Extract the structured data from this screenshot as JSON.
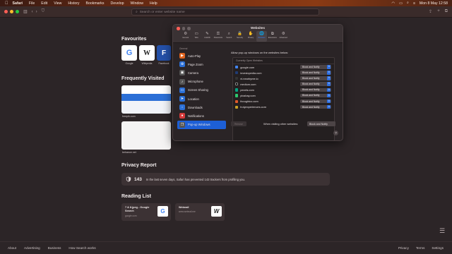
{
  "menubar": {
    "app": "Safari",
    "items": [
      "File",
      "Edit",
      "View",
      "History",
      "Bookmarks",
      "Develop",
      "Window",
      "Help"
    ],
    "datetime": "Mon 8 May  12:58"
  },
  "toolbar": {
    "address_placeholder": "Search or enter website name"
  },
  "start_page": {
    "favourites_title": "Favourites",
    "favourites": [
      {
        "label": "Google",
        "glyph": "G",
        "color": "#4285F4",
        "bg": "#ffffff"
      },
      {
        "label": "Wikipedia",
        "glyph": "W",
        "color": "#222222",
        "bg": "#ffffff"
      },
      {
        "label": "Facebook",
        "glyph": "F",
        "color": "#ffffff",
        "bg": "#2450a8"
      }
    ],
    "frequently_title": "Frequently Visited",
    "frequently": [
      {
        "label": "freepik.com"
      },
      {
        "label": "behance.net"
      }
    ],
    "privacy_title": "Privacy Report",
    "privacy_count": "143",
    "privacy_text": "In the last seven days, Safari has prevented 143 trackers from profiling you.",
    "reading_title": "Reading List",
    "reading": [
      {
        "title": "7 & 8.jpeg - Google Search",
        "sub": "google.com",
        "glyph": "G",
        "color": "#4285F4"
      },
      {
        "title": "Webnail",
        "sub": "www.webnail.me",
        "glyph": "W",
        "color": "#222222"
      }
    ]
  },
  "footer": {
    "left": [
      "About",
      "Advertising",
      "Business",
      "How Search works"
    ],
    "right": [
      "Privacy",
      "Terms",
      "Settings"
    ]
  },
  "prefs": {
    "title": "Websites",
    "tabs": [
      {
        "label": "General",
        "icon": "⚙"
      },
      {
        "label": "Tabs",
        "icon": "▭"
      },
      {
        "label": "AutoFill",
        "icon": "✎"
      },
      {
        "label": "Passwords",
        "icon": "⚿"
      },
      {
        "label": "Search",
        "icon": "⌕"
      },
      {
        "label": "Security",
        "icon": "🔒"
      },
      {
        "label": "Privacy",
        "icon": "✋"
      },
      {
        "label": "Websites",
        "icon": "🌐"
      },
      {
        "label": "Extensions",
        "icon": "⧉"
      },
      {
        "label": "Advanced",
        "icon": "⚙"
      }
    ],
    "active_tab": 7,
    "sidebar_header": "General",
    "sidebar": [
      {
        "label": "Auto-Play",
        "icon": "▶",
        "color": "#e0641f"
      },
      {
        "label": "Page Zoom",
        "icon": "⊕",
        "color": "#2b6fd6"
      },
      {
        "label": "Camera",
        "icon": "▣",
        "color": "#555555"
      },
      {
        "label": "Microphone",
        "icon": "♪",
        "color": "#555555"
      },
      {
        "label": "Screen Sharing",
        "icon": "▭",
        "color": "#2b6fd6"
      },
      {
        "label": "Location",
        "icon": "➤",
        "color": "#2b6fd6"
      },
      {
        "label": "Downloads",
        "icon": "↓",
        "color": "#2b6fd6"
      },
      {
        "label": "Notifications",
        "icon": "●",
        "color": "#d63a3a"
      },
      {
        "label": "Pop-up Windows",
        "icon": "❐",
        "color": "#555555"
      }
    ],
    "active_sidebar": 8,
    "intro": "Allow pop-up windows on the websites below:",
    "list_header": "Currently Open Websites",
    "sites": [
      {
        "name": "google.com",
        "value": "Block and Notify",
        "fav": "#4285F4"
      },
      {
        "name": "investopedia.com",
        "value": "Block and Notify",
        "fav": "#1f3b73"
      },
      {
        "name": "ni.nearbyme.io",
        "value": "Block and Notify",
        "fav": "#333333"
      },
      {
        "name": "medium.com",
        "value": "Block and Notify",
        "fav": "#000000"
      },
      {
        "name": "pexels.com",
        "value": "Block and Notify",
        "fav": "#05a081"
      },
      {
        "name": "pixabay.com",
        "value": "Block and Notify",
        "fav": "#2ec66d"
      },
      {
        "name": "thoughtco.com",
        "value": "Block and Notify",
        "fav": "#e05a2a"
      },
      {
        "name": "trulyexperiences.com",
        "value": "Block and Notify",
        "fav": "#c9a227"
      }
    ],
    "remove_label": "Remove",
    "other_label": "When visiting other websites:",
    "other_value": "Block and Notify",
    "help": "?"
  }
}
